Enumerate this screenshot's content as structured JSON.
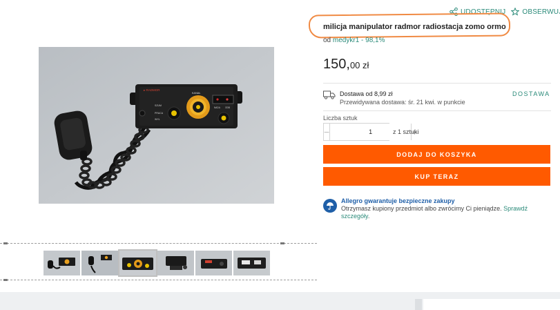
{
  "header_actions": {
    "share_label": "UDOSTĘPNIJ",
    "watch_label": "OBSERWUJ"
  },
  "product": {
    "title": "milicja manipulator radmor radiostacja zomo ormo",
    "seller_prefix": "od",
    "seller_name": "medykr1",
    "seller_rating": "- 98,1%",
    "price_main": "150,",
    "price_cents": "00 zł"
  },
  "delivery": {
    "cost": "Dostawa od 8,99 zł",
    "eta": "Przewidywana dostawa: śr. 21 kwi. w punkcie",
    "link_label": "DOSTAWA",
    "icon": "truck-icon"
  },
  "quantity": {
    "label": "Liczba sztuk",
    "value": "1",
    "minus": "−",
    "plus": "+",
    "of_total": "z 1 sztuki"
  },
  "buttons": {
    "add_to_cart": "DODAJ DO KOSZYKA",
    "buy_now": "KUP TERAZ"
  },
  "guarantee": {
    "title": "Allegro gwarantuje bezpieczne zakupy",
    "text": "Otrzymasz kupiony przedmiot albo zwrócimy Ci pieniądze.",
    "link": "Sprawdź szczegóły",
    "suffix": ".",
    "icon": "umbrella-icon"
  },
  "colors": {
    "accent": "#2a8a79",
    "cta": "#ff5a00",
    "highlight": "#f08a43",
    "guarantee": "#1f5fa8"
  },
  "gallery": {
    "thumb_count": 6,
    "device_labels": {
      "brand": "▸ RADMOR",
      "channel": "KANAŁ",
      "left_knob": "SZUM",
      "mid_left": "PRACA",
      "lower_left": "WYŁ",
      "right_box_a": "NADA",
      "right_box_b": "ODB"
    }
  }
}
